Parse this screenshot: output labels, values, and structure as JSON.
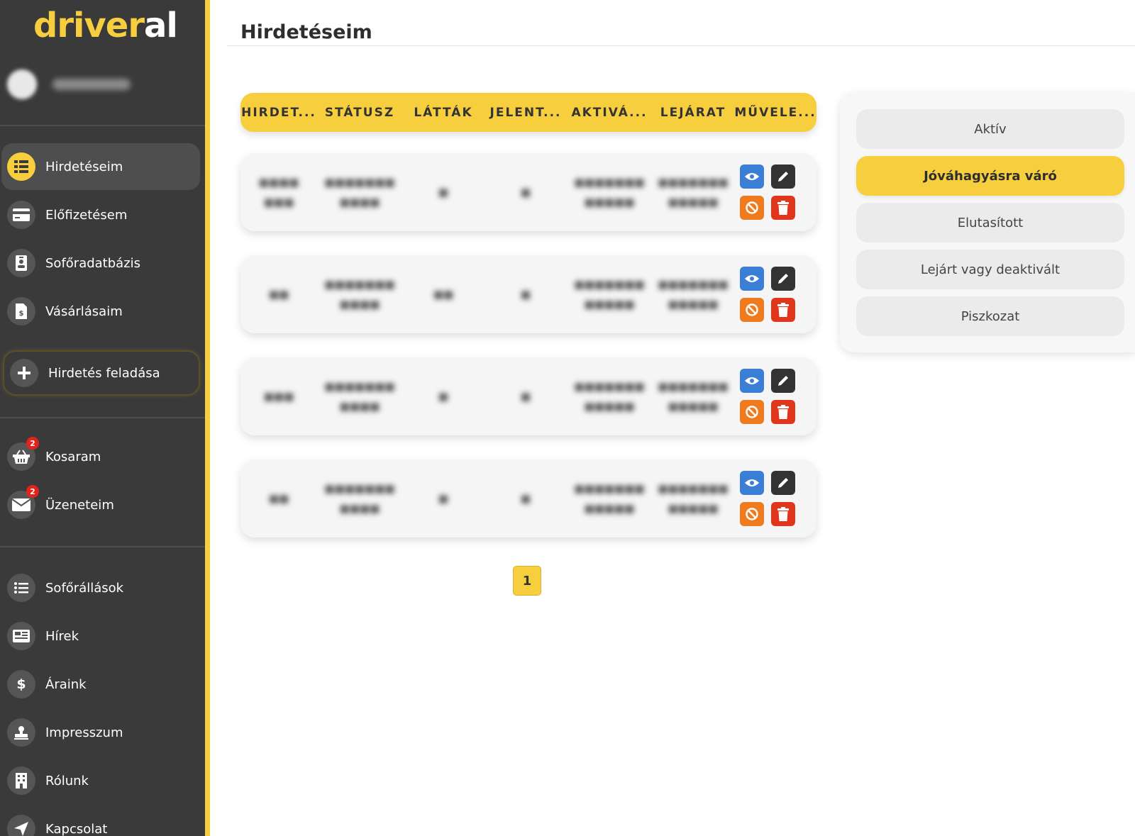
{
  "brand": {
    "logo_part1": "driver",
    "logo_part2": "al"
  },
  "nav": {
    "main": [
      {
        "label": "Hirdetéseim",
        "icon": "list-icon"
      },
      {
        "label": "Előfizetésem",
        "icon": "credit-card-icon"
      },
      {
        "label": "Sofőradatbázis",
        "icon": "id-badge-icon"
      },
      {
        "label": "Vásárlásaim",
        "icon": "invoice-icon"
      }
    ],
    "post_button": "Hirdetés feladása",
    "secondary": [
      {
        "label": "Kosaram",
        "icon": "basket-icon",
        "badge": "2"
      },
      {
        "label": "Üzeneteim",
        "icon": "envelope-icon",
        "badge": "2"
      }
    ],
    "info": [
      {
        "label": "Sofőrállások",
        "icon": "bullet-list-icon"
      },
      {
        "label": "Hírek",
        "icon": "newspaper-icon"
      },
      {
        "label": "Áraink",
        "icon": "dollar-icon"
      },
      {
        "label": "Impresszum",
        "icon": "stamp-icon"
      },
      {
        "label": "Rólunk",
        "icon": "building-icon"
      },
      {
        "label": "Kapcsolat",
        "icon": "paper-plane-icon"
      }
    ]
  },
  "page": {
    "title": "Hirdetéseim"
  },
  "table": {
    "headers": [
      "HIRDET...",
      "STÁTUSZ",
      "LÁTTÁK",
      "JELENT...",
      "AKTIVÁ...",
      "LEJÁRAT",
      "MŰVELE..."
    ]
  },
  "pagination": {
    "current": "1"
  },
  "filters": {
    "items": [
      "Aktív",
      "Jóváhagyásra váró",
      "Elutasított",
      "Lejárt vagy deaktivált",
      "Piszkozat"
    ],
    "active": "Jóváhagyásra váró"
  },
  "colors": {
    "accent": "#f7ce3e",
    "sidebar": "#3a3a3a",
    "view": "#3a7fd5",
    "edit": "#333333",
    "block": "#f07b1e",
    "delete": "#e2361c"
  }
}
